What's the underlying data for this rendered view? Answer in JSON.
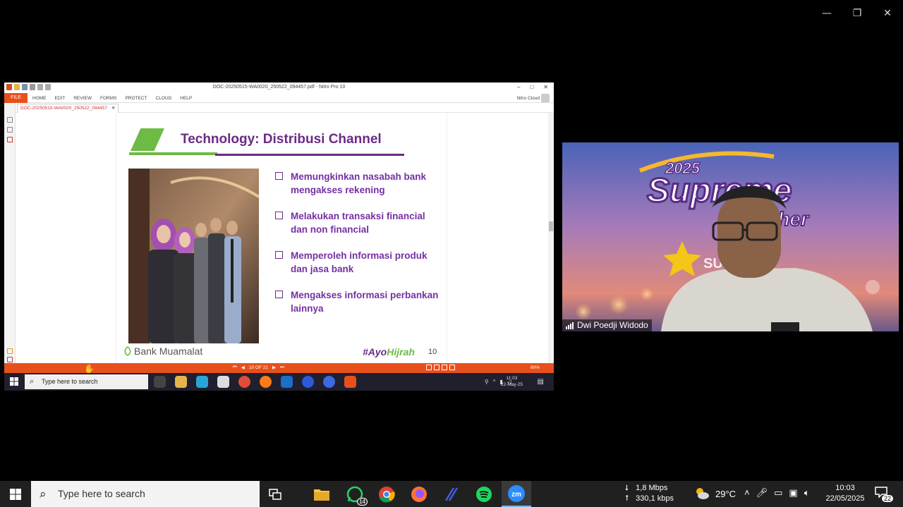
{
  "zoom_window": {
    "controls": {
      "minimize": "—",
      "restore": "❐",
      "close": "✕"
    }
  },
  "nitro": {
    "title": "DOC-20250515-WA0020_250522_094457.pdf - Nitro Pro 10",
    "window_controls": {
      "min": "–",
      "max": "□",
      "close": "✕"
    },
    "menu": {
      "file": "FILE",
      "items": [
        "HOME",
        "EDIT",
        "REVIEW",
        "FORMS",
        "PROTECT",
        "CLOUD",
        "HELP"
      ],
      "cloud": "Nitro Cloud"
    },
    "tab": {
      "label": "DOC-20250515-WA0020_250522_094457",
      "close": "✕"
    },
    "status": {
      "page": "10 OF 21",
      "zoom": "80%"
    },
    "taskbar": {
      "search_placeholder": "Type here to search",
      "time": "11:03",
      "date": "22-May-25"
    }
  },
  "slide": {
    "title": "Technology: Distribusi Channel",
    "bullets": [
      "Memungkinkan nasabah bank mengakses rekening",
      "Melakukan transaksi financial dan non financial",
      "Memperoleh informasi produk dan jasa bank",
      "Mengakses informasi perbankan lainnya"
    ],
    "brand": "Bank Muamalat",
    "hashtag_a": "#Ayo",
    "hashtag_b": "Hijrah",
    "page_number": "10",
    "colors": {
      "purple": "#6b2a86",
      "green": "#6dbb45"
    }
  },
  "webcam": {
    "participant_name": "Dwi Poedji Widodo",
    "banner_year": "2025",
    "banner_word": "Supreme",
    "banner_word2": "ther",
    "banner_logo": "SU    RUA"
  },
  "taskbar": {
    "search_placeholder": "Type here to search",
    "whatsapp_badge": "14",
    "net_down": "1,8 Mbps",
    "net_up": "330,1 kbps",
    "temperature": "29°C",
    "time": "10:03",
    "date": "22/05/2025",
    "notifications": "22"
  }
}
